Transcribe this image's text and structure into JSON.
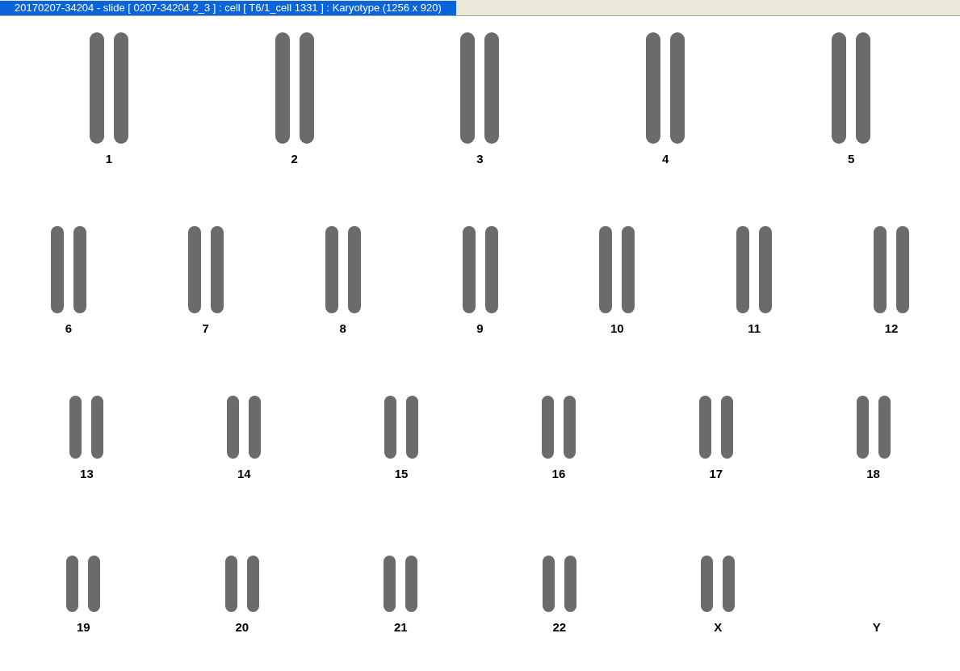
{
  "window": {
    "title": "20170207-34204 - slide [ 0207-34204 2_3 ] : cell [ T6/1_cell 1331 ] : Karyotype  (1256 x 920)"
  },
  "rows": [
    {
      "pairs": [
        {
          "label": "1",
          "empty": false
        },
        {
          "label": "2",
          "empty": false
        },
        {
          "label": "3",
          "empty": false
        },
        {
          "label": "4",
          "empty": false
        },
        {
          "label": "5",
          "empty": false
        }
      ]
    },
    {
      "pairs": [
        {
          "label": "6",
          "empty": false
        },
        {
          "label": "7",
          "empty": false
        },
        {
          "label": "8",
          "empty": false
        },
        {
          "label": "9",
          "empty": false
        },
        {
          "label": "10",
          "empty": false
        },
        {
          "label": "11",
          "empty": false
        },
        {
          "label": "12",
          "empty": false
        }
      ]
    },
    {
      "pairs": [
        {
          "label": "13",
          "empty": false
        },
        {
          "label": "14",
          "empty": false
        },
        {
          "label": "15",
          "empty": false
        },
        {
          "label": "16",
          "empty": false
        },
        {
          "label": "17",
          "empty": false
        },
        {
          "label": "18",
          "empty": false
        }
      ]
    },
    {
      "pairs": [
        {
          "label": "19",
          "empty": false
        },
        {
          "label": "20",
          "empty": false
        },
        {
          "label": "21",
          "empty": false
        },
        {
          "label": "22",
          "empty": false
        },
        {
          "label": "X",
          "empty": false
        },
        {
          "label": "Y",
          "empty": true
        }
      ]
    }
  ]
}
